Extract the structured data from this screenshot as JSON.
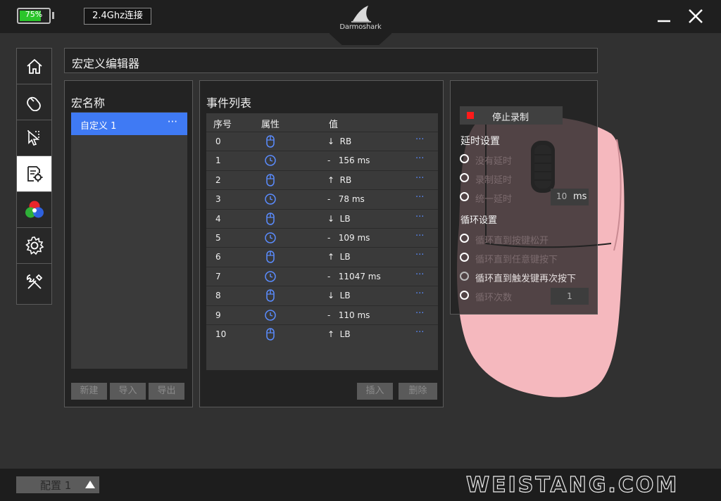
{
  "header": {
    "battery_label": "75%",
    "battery_level": 0.75,
    "connection_label": "2.4Ghz连接",
    "logo_text": "Darmoshark"
  },
  "sidebar": {
    "items": [
      {
        "icon": "home-icon"
      },
      {
        "icon": "mouse-icon"
      },
      {
        "icon": "pointer-settings-icon"
      },
      {
        "icon": "macro-editor-icon",
        "active": true
      },
      {
        "icon": "rgb-lighting-icon"
      },
      {
        "icon": "gear-icon"
      },
      {
        "icon": "tools-icon"
      }
    ]
  },
  "page_title": "宏定义编辑器",
  "macro_panel": {
    "title": "宏名称",
    "items": [
      {
        "label": "自定义 1",
        "more": "···"
      }
    ],
    "buttons": {
      "new": "新建",
      "import": "导入",
      "export": "导出"
    }
  },
  "event_panel": {
    "title": "事件列表",
    "headers": {
      "index": "序号",
      "attribute": "属性",
      "value": "值"
    },
    "rows": [
      {
        "index": "0",
        "type": "mouse-icon",
        "value": "↓  RB"
      },
      {
        "index": "1",
        "type": "clock-icon",
        "value": "-   156 ms"
      },
      {
        "index": "2",
        "type": "mouse-icon",
        "value": "↑  RB"
      },
      {
        "index": "3",
        "type": "clock-icon",
        "value": "-   78 ms"
      },
      {
        "index": "4",
        "type": "mouse-icon",
        "value": "↓  LB"
      },
      {
        "index": "5",
        "type": "clock-icon",
        "value": "-   109 ms"
      },
      {
        "index": "6",
        "type": "mouse-icon",
        "value": "↑  LB"
      },
      {
        "index": "7",
        "type": "clock-icon",
        "value": "-   11047 ms"
      },
      {
        "index": "8",
        "type": "mouse-icon",
        "value": "↓  LB"
      },
      {
        "index": "9",
        "type": "clock-icon",
        "value": "-   110 ms"
      },
      {
        "index": "10",
        "type": "mouse-icon",
        "value": "↑  LB"
      }
    ],
    "row_more": "···",
    "buttons": {
      "insert": "插入",
      "delete": "删除"
    }
  },
  "settings": {
    "stop_record": "停止录制",
    "delay_title": "延时设置",
    "delay_options": [
      "没有延时",
      "录制延时",
      "统一延时"
    ],
    "delay_value": "10",
    "delay_unit": "ms",
    "loop_title": "循环设置",
    "loop_options": [
      "循环直到按键松开",
      "循环直到任意键按下",
      "循环直到触发键再次按下",
      "循环次数"
    ],
    "loop_count": "1"
  },
  "footer": {
    "profile_label": "配置 1",
    "watermark": "WEISTANG.COM"
  },
  "colors": {
    "accent": "#3f7af4",
    "record": "#ff1a1a",
    "battery": "#2bc52b",
    "mouse_body": "#f5b8be"
  }
}
